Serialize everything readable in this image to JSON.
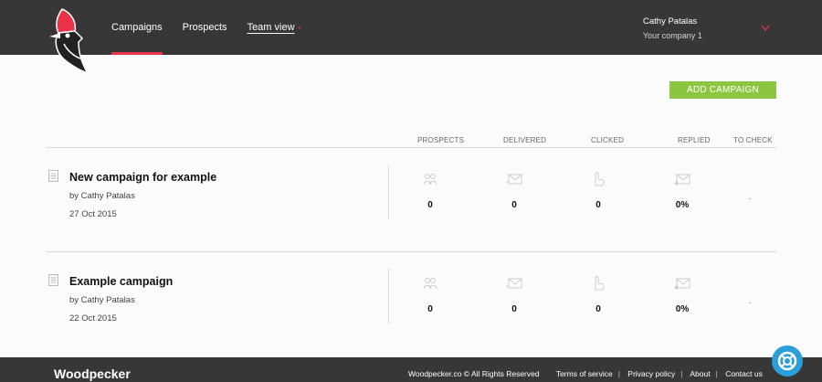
{
  "header": {
    "nav": [
      {
        "label": "Campaigns"
      },
      {
        "label": "Prospects"
      },
      {
        "label": "Team view"
      }
    ],
    "user_name": "Cathy Patalas",
    "user_company": "Your company 1"
  },
  "toolbar": {
    "add_campaign_label": "ADD CAMPAIGN"
  },
  "table": {
    "columns": [
      "PROSPECTS",
      "DELIVERED",
      "CLICKED",
      "REPLIED",
      "TO CHECK"
    ],
    "rows": [
      {
        "title": "New campaign for example",
        "author": "by Cathy Patalas",
        "date": "27 Oct 2015",
        "prospects": "0",
        "delivered": "0",
        "clicked": "0",
        "replied": "0%",
        "to_check": "-"
      },
      {
        "title": "Example campaign",
        "author": "by Cathy Patalas",
        "date": "22 Oct 2015",
        "prospects": "0",
        "delivered": "0",
        "clicked": "0",
        "replied": "0%",
        "to_check": "-"
      }
    ]
  },
  "footer": {
    "brand": "Woodpecker",
    "copyright": "Woodpecker.co © All Rights Reserved",
    "links": [
      "Terms of service",
      "Privacy policy",
      "About",
      "Contact us"
    ]
  },
  "colors": {
    "header_bg": "#383737",
    "accent_red": "#e8324a",
    "button_green": "#8cc63f",
    "help_blue": "#2b9fd8"
  }
}
